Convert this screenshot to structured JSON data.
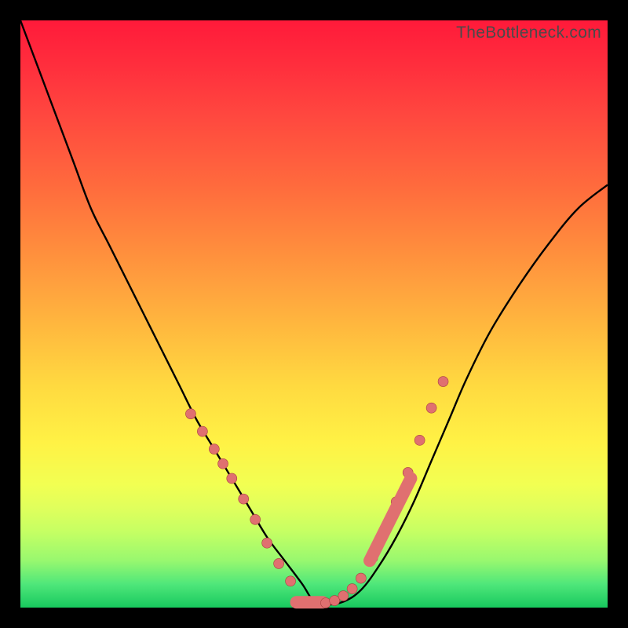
{
  "watermark": "TheBottleneck.com",
  "chart_data": {
    "type": "line",
    "title": "",
    "xlabel": "",
    "ylabel": "",
    "xlim": [
      0,
      100
    ],
    "ylim": [
      0,
      100
    ],
    "curve": {
      "x": [
        0,
        3,
        6,
        9,
        12,
        15,
        18,
        21,
        24,
        27,
        30,
        33,
        36,
        39,
        42,
        45,
        48,
        50,
        52,
        55,
        58,
        61,
        64,
        67,
        70,
        73,
        76,
        80,
        85,
        90,
        95,
        100
      ],
      "y": [
        100,
        92,
        84,
        76,
        68,
        62,
        56,
        50,
        44,
        38,
        32,
        27,
        22,
        17,
        12,
        8,
        4,
        1,
        0.5,
        1,
        3,
        7,
        12,
        18,
        25,
        32,
        39,
        47,
        55,
        62,
        68,
        72
      ]
    },
    "markers_left": {
      "x": [
        29,
        31,
        33,
        34.5,
        36,
        38,
        40,
        42,
        44,
        46
      ],
      "y": [
        33,
        30,
        27,
        24.5,
        22,
        18.5,
        15,
        11,
        7.5,
        4.5
      ]
    },
    "pill_left": {
      "x0": 47,
      "x1": 51.5,
      "y": 0.9
    },
    "markers_right": {
      "x": [
        52,
        53.5,
        55,
        56.5,
        58,
        60,
        62,
        64,
        66,
        68,
        70,
        72
      ],
      "y": [
        0.8,
        1.2,
        2.0,
        3.2,
        5.0,
        8.5,
        13.0,
        18.0,
        23.0,
        28.5,
        34.0,
        38.5
      ]
    },
    "pill_right": {
      "x0": 59.5,
      "x1": 66.5,
      "y0": 8,
      "y1": 22
    }
  },
  "colors": {
    "curve": "#000000",
    "marker_fill": "#e07070",
    "marker_stroke": "#a84040"
  }
}
